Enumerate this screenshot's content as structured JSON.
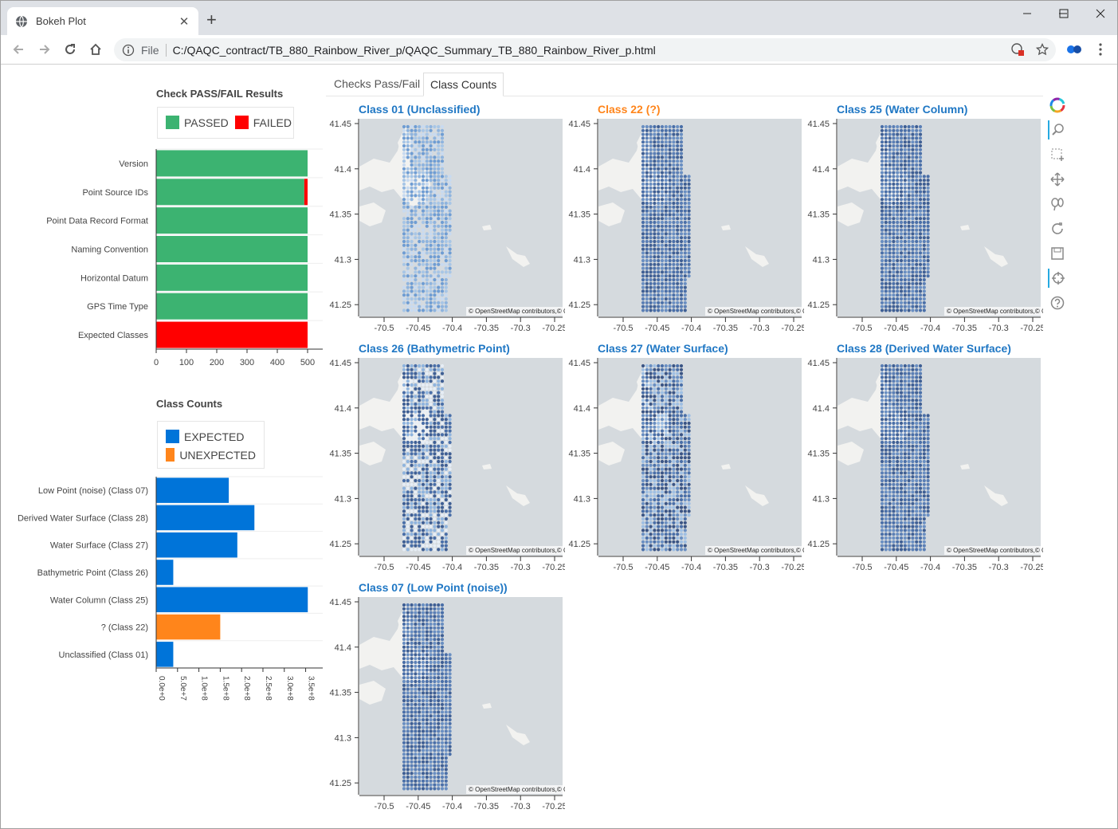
{
  "browser": {
    "tab_title": "Bokeh Plot",
    "new_tab_label": "+",
    "close_label": "✕",
    "file_label": "File",
    "url": "C:/QAQC_contract/TB_880_Rainbow_River_p/QAQC_Summary_TB_880_Rainbow_River_p.html"
  },
  "doc_tabs": [
    {
      "label": "Checks Pass/Fail",
      "active": false
    },
    {
      "label": "Class Counts",
      "active": true
    }
  ],
  "passfail": {
    "title": "Check PASS/FAIL Results",
    "legend": [
      {
        "label": "PASSED",
        "color": "#3cb371"
      },
      {
        "label": "FAILED",
        "color": "#ff0000"
      }
    ]
  },
  "class_counts": {
    "title": "Class Counts",
    "legend": [
      {
        "label": "EXPECTED",
        "color": "#0074d9"
      },
      {
        "label": "UNEXPECTED",
        "color": "#ff851b"
      }
    ]
  },
  "chart_data": [
    {
      "type": "bar",
      "orientation": "horizontal",
      "stacked": true,
      "categories": [
        "Version",
        "Point Source IDs",
        "Point Data Record Format",
        "Naming Convention",
        "Horizontal Datum",
        "GPS Time Type",
        "Expected Classes"
      ],
      "series": [
        {
          "name": "PASSED",
          "color": "#3cb371",
          "values": [
            500,
            489,
            500,
            500,
            500,
            500,
            0
          ]
        },
        {
          "name": "FAILED",
          "color": "#ff0000",
          "values": [
            0,
            11,
            0,
            0,
            0,
            0,
            500
          ]
        }
      ],
      "xlim": [
        0,
        550
      ],
      "xticks": [
        "0",
        "100",
        "200",
        "300",
        "400",
        "500"
      ]
    },
    {
      "type": "bar",
      "orientation": "horizontal",
      "categories": [
        "Low Point (noise) (Class 07)",
        "Derived Water Surface (Class 28)",
        "Water Surface (Class 27)",
        "Bathymetric Point (Class 26)",
        "Water Column (Class 25)",
        "? (Class 22)",
        "Unclassified (Class 01)"
      ],
      "values": [
        170000000,
        230000000,
        190000000,
        40000000,
        355000000,
        150000000,
        40000000
      ],
      "colors": [
        "#0074d9",
        "#0074d9",
        "#0074d9",
        "#0074d9",
        "#0074d9",
        "#ff851b",
        "#0074d9"
      ],
      "xlim": [
        0,
        390000000
      ],
      "xticks": [
        "0.0e+0",
        "5.0e+7",
        "1.0e+8",
        "1.5e+8",
        "2.0e+8",
        "2.5e+8",
        "3.0e+8",
        "3.5e+8"
      ]
    }
  ],
  "maps": [
    {
      "title": "Class 01 (Unclassified)",
      "color": "#1f77c4",
      "pattern": "sparse"
    },
    {
      "title": "Class 22 (?)",
      "color": "#ff851b",
      "pattern": "dense"
    },
    {
      "title": "Class 25 (Water Column)",
      "color": "#1f77c4",
      "pattern": "dense"
    },
    {
      "title": "Class 26 (Bathymetric Point)",
      "color": "#1f77c4",
      "pattern": "mixed"
    },
    {
      "title": "Class 27 (Water Surface)",
      "color": "#1f77c4",
      "pattern": "dark"
    },
    {
      "title": "Class 28 (Derived Water Surface)",
      "color": "#1f77c4",
      "pattern": "dense"
    },
    {
      "title": "Class 07 (Low Point (noise))",
      "color": "#1f77c4",
      "pattern": "dense"
    }
  ],
  "map_axes": {
    "yticks": [
      "41.45",
      "41.4",
      "41.35",
      "41.3",
      "41.25"
    ],
    "xticks": [
      "-70.5",
      "-70.45",
      "-70.4",
      "-70.35",
      "-70.3",
      "-70.25"
    ],
    "attribution": "© OpenStreetMap contributors,© CartoDB"
  },
  "tools": [
    "bokeh-logo-icon",
    "zoom-icon",
    "box-select-icon",
    "pan-icon",
    "lasso-icon",
    "reset-icon",
    "save-icon",
    "crosshair-icon",
    "help-icon"
  ]
}
